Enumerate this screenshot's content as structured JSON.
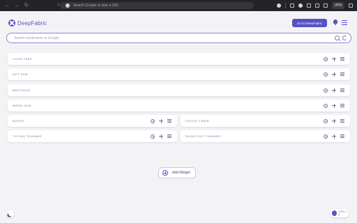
{
  "browser": {
    "omnibox_placeholder": "Search Google or type a URL",
    "vpn_label": "VPN"
  },
  "header": {
    "logo_text": "DeepFabric",
    "go_button": "Go to DeepFabric"
  },
  "search": {
    "placeholder": "Search bookmarks or Google"
  },
  "widgets": [
    {
      "label": "YOUR TABS"
    },
    {
      "label": "GPT HUB"
    },
    {
      "label": "MEETINGS"
    },
    {
      "label": "WORK HUB"
    },
    {
      "label": "NOTES"
    },
    {
      "label": "FOCUS TIMER"
    },
    {
      "label": "TYPING TRAINER"
    },
    {
      "label": "SHORTCUT TRAINER"
    }
  ],
  "add_widget": {
    "label": "Add Widget"
  },
  "footer": {
    "shortcut_label": "CTRL + K"
  },
  "colors": {
    "brand": "#5751c6",
    "background": "#f3f3f6"
  }
}
